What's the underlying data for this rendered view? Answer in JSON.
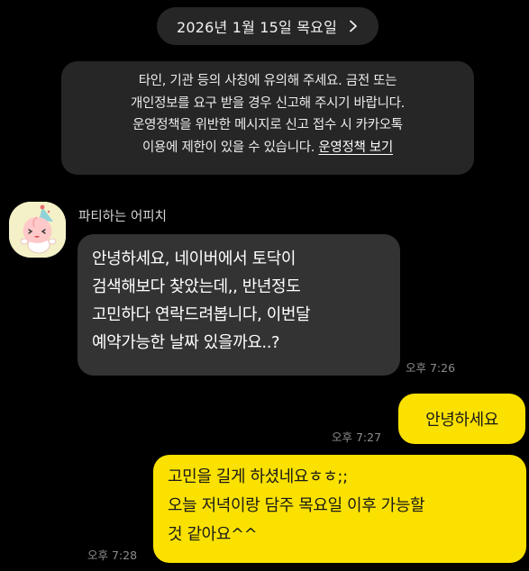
{
  "date_header": {
    "label": "2026년 1월 15일 목요일",
    "chevron_icon": "chevron-right-icon"
  },
  "safety_notice": {
    "lines": [
      "타인, 기관 등의 사칭에 유의해 주세요. 금전 또는",
      "개인정보를 요구 받을 경우 신고해 주시기 바랍니다.",
      "운영정책을 위반한 메시지로 신고 접수 시 카카오톡",
      "이용에 제한이 있을 수 있습니다."
    ],
    "link_label": "운영정책 보기"
  },
  "incoming": {
    "sender_name": "파티하는 어피치",
    "avatar_icon": "apeach-avatar-icon",
    "message_lines": [
      "안녕하세요, 네이버에서 토닥이",
      "검색해보다 찾았는데,, 반년정도",
      "고민하다 연락드려봅니다, 이번달",
      "예약가능한 날짜 있을까요..?"
    ],
    "time": "오후 7:26"
  },
  "outgoing": [
    {
      "message_lines": [
        "안녕하세요"
      ],
      "time": "오후 7:27"
    },
    {
      "message_lines": [
        "고민을 길게 하셨네요ㅎㅎ;;",
        "오늘 저녁이랑 담주 목요일 이후 가능할",
        "것 같아요^^"
      ],
      "time": "오후 7:28"
    }
  ],
  "colors": {
    "background": "#000000",
    "system_bubble": "#262626",
    "incoming_bubble": "#333333",
    "outgoing_bubble": "#fae100",
    "timestamp": "#8c8c8c"
  }
}
